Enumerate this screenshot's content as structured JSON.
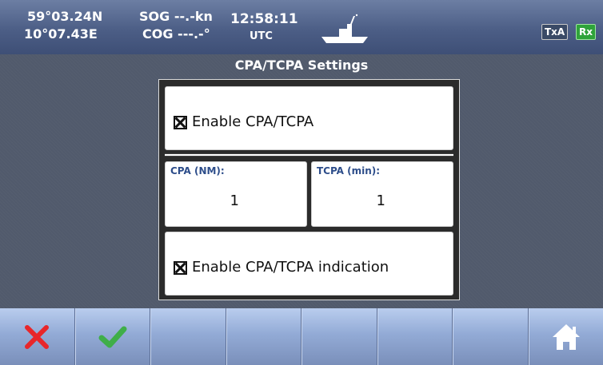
{
  "header": {
    "latitude": "59°03.24N",
    "longitude": "10°07.43E",
    "sog": "SOG --.-kn",
    "cog": "COG ---.-°",
    "time": "12:58:11",
    "timezone": "UTC",
    "tx_badge": "TxA",
    "rx_badge": "Rx"
  },
  "title": "CPA/TCPA Settings",
  "settings": {
    "enable_label": "Enable CPA/TCPA",
    "enable_checked": true,
    "cpa_label": "CPA (NM):",
    "cpa_value": "1",
    "tcpa_label": "TCPA (min):",
    "tcpa_value": "1",
    "indication_label": "Enable CPA/TCPA indication",
    "indication_checked": true
  },
  "toolbar": {
    "buttons": [
      "cancel-icon",
      "confirm-icon",
      "",
      "",
      "",
      "",
      "",
      "home-icon"
    ]
  },
  "colors": {
    "accent": "#2d4d8a",
    "cancel": "#e8262a",
    "confirm": "#3fae49",
    "rx": "#2fa33a"
  }
}
